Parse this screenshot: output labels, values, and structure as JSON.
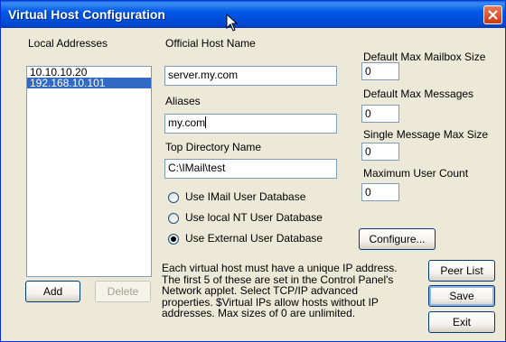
{
  "window": {
    "title": "Virtual Host Configuration"
  },
  "local_addresses": {
    "label": "Local Addresses",
    "items": [
      {
        "text": "10.10.10.20",
        "selected": false
      },
      {
        "text": "192.168.10.101",
        "selected": true
      }
    ],
    "add_label": "Add",
    "delete_label": "Delete"
  },
  "official_host_name": {
    "label": "Official Host Name",
    "value": "server.my.com"
  },
  "aliases": {
    "label": "Aliases",
    "value": "my.com"
  },
  "top_directory": {
    "label": "Top Directory Name",
    "value": "C:\\IMail\\test"
  },
  "user_database": {
    "options": [
      {
        "label": "Use IMail User Database",
        "checked": false
      },
      {
        "label": "Use local NT User Database",
        "checked": false
      },
      {
        "label": "Use External User Database",
        "checked": true
      }
    ],
    "configure_label": "Configure..."
  },
  "limits": {
    "max_mailbox_size": {
      "label": "Default Max Mailbox Size",
      "value": "0"
    },
    "max_messages": {
      "label": "Default Max Messages",
      "value": "0"
    },
    "single_message_max_size": {
      "label": "Single Message Max Size",
      "value": "0"
    },
    "max_user_count": {
      "label": "Maximum User Count",
      "value": "0"
    }
  },
  "note": {
    "lines": [
      "Each virtual host must have a unique IP address.",
      "The first 5 of these are set in the Control Panel's",
      "Network applet.  Select TCP/IP advanced",
      "properties.  $Virtual IPs allow hosts without IP",
      "addresses.  Max sizes of 0 are unlimited."
    ]
  },
  "buttons": {
    "peer_list": "Peer List",
    "save": "Save",
    "exit": "Exit"
  },
  "colors": {
    "titlebar": "#0058e6",
    "selection": "#316ac5",
    "dialog": "#ece9d8"
  }
}
